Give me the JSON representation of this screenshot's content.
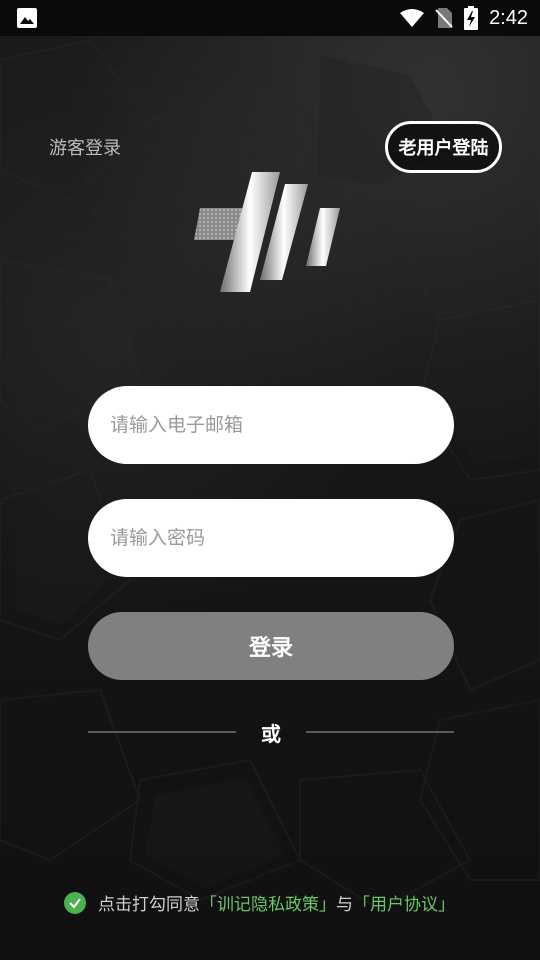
{
  "status_bar": {
    "time": "2:42",
    "icons": [
      "image-icon",
      "wifi-icon",
      "no-sim-icon",
      "battery-charging-icon"
    ]
  },
  "top": {
    "guest_login": "游客登录",
    "old_user_login": "老用户登陆"
  },
  "form": {
    "email_placeholder": "请输入电子邮箱",
    "email_value": "",
    "password_placeholder": "请输入密码",
    "password_value": "",
    "login_button": "登录",
    "or_text": "或"
  },
  "agreement": {
    "prefix": "点击打勾同意",
    "privacy_link": "「训记隐私政策」",
    "joiner": "与",
    "terms_link": "「用户协议」",
    "checked": true
  },
  "colors": {
    "accent_green": "#6cc66a",
    "button_gray": "#808080",
    "background": "#141414"
  }
}
